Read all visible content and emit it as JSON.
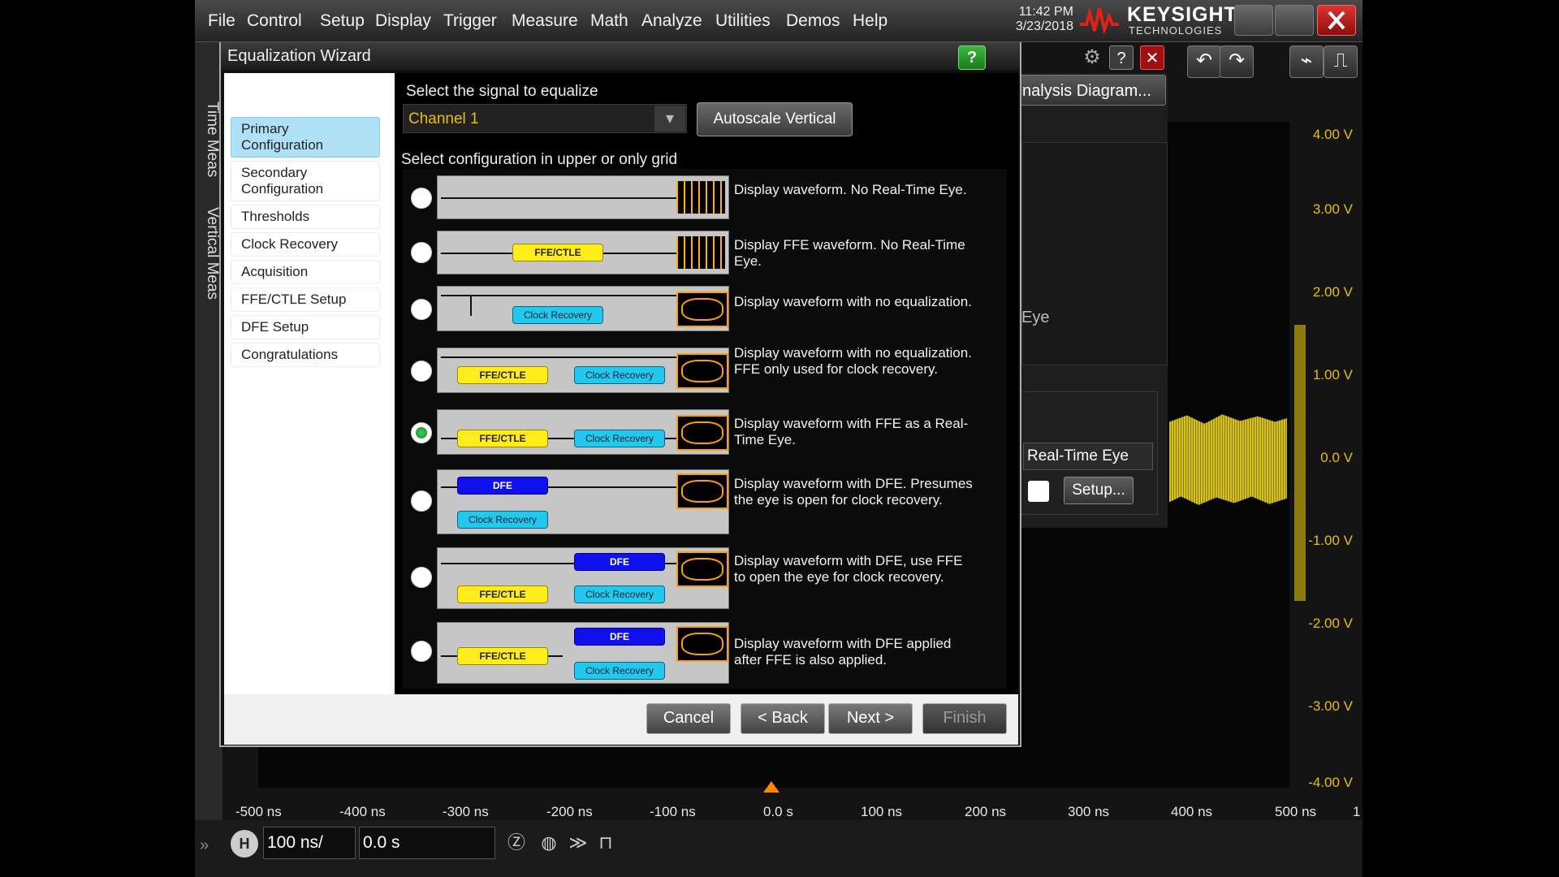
{
  "menubar": {
    "items": [
      "File",
      "Control",
      "Setup",
      "Display",
      "Trigger",
      "Measure",
      "Math",
      "Analyze",
      "Utilities",
      "Demos",
      "Help"
    ],
    "time": "11:42 PM",
    "date": "3/23/2018",
    "brand": "KEYSIGHT",
    "brand_sub": "TECHNOLOGIES"
  },
  "rail": {
    "tab1": "Time Meas",
    "tab2": "Vertical Meas"
  },
  "dialog": {
    "title": "Equalization Wizard",
    "help": "?",
    "nav": [
      "Primary Configuration",
      "Secondary Configuration",
      "Thresholds",
      "Clock Recovery",
      "Acquisition",
      "FFE/CTLE Setup",
      "DFE Setup",
      "Congratulations"
    ],
    "nav_active": 0,
    "signal_label": "Select the signal to equalize",
    "channel_value": "Channel 1",
    "autoscale_label": "Autoscale Vertical",
    "config_label": "Select configuration in upper or only grid",
    "options": [
      "Display waveform. No Real-Time Eye.",
      "Display FFE waveform. No Real-Time Eye.",
      "Display waveform with no equalization.",
      "Display waveform with no equalization. FFE only used for clock recovery.",
      "Display waveform with FFE as a Real-Time Eye.",
      "Display waveform with DFE. Presumes the eye is open for clock recovery.",
      "Display waveform with DFE, use FFE to open the eye for clock recovery.",
      "Display waveform with DFE applied after FFE is also applied."
    ],
    "selected_option": 4,
    "blocks": {
      "ffe": "FFE/CTLE",
      "clock": "Clock Recovery",
      "dfe": "DFE"
    },
    "buttons": {
      "cancel": "Cancel",
      "back": "< Back",
      "next": "Next >",
      "finish": "Finish"
    }
  },
  "side": {
    "analysis": "nalysis Diagram...",
    "eye": "Eye",
    "rte": "Real-Time Eye",
    "setup": "Setup..."
  },
  "yaxis": [
    "4.00 V",
    "3.00 V",
    "2.00 V",
    "1.00 V",
    "0.0 V",
    "-1.00 V",
    "-2.00 V",
    "-3.00 V",
    "-4.00 V"
  ],
  "xaxis": [
    "-500 ns",
    "-400 ns",
    "-300 ns",
    "-200 ns",
    "-100 ns",
    "0.0 s",
    "100 ns",
    "200 ns",
    "300 ns",
    "400 ns",
    "500 ns",
    "1"
  ],
  "bottom": {
    "h": "H",
    "timebase": "100 ns/",
    "delay": "0.0 s"
  },
  "colors": {
    "accent": "#e8c000",
    "selected_nav": "#aee0f6",
    "brand_red": "#e0201a"
  }
}
